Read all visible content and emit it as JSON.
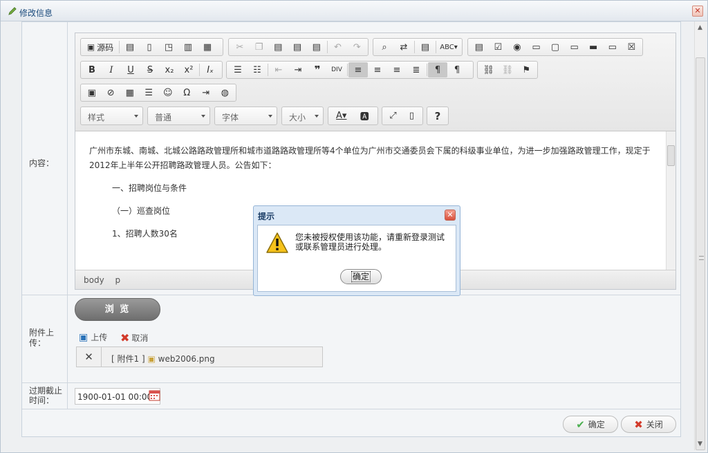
{
  "window": {
    "title": "修改信息",
    "close_glyph": "✕"
  },
  "form": {
    "content_label": "内容：",
    "attachment_label": "附件上传：",
    "deadline_label": "过期截止时间："
  },
  "toolbar": {
    "source_label": "源码",
    "style_combo": "样式",
    "format_combo": "普通",
    "font_combo": "字体",
    "size_combo": "大小"
  },
  "editor": {
    "paragraph1": "广州市东城、南城、北城公路路政管理所和城市道路路政管理所等4个单位为广州市交通委员会下属的科级事业单位，为进一步加强路政管理工作，现定于2012年上半年公开招聘路政管理人员。公告如下：",
    "paragraph2": "一、招聘岗位与条件",
    "paragraph3": "（一）巡查岗位",
    "paragraph4": "1、招聘人数30名",
    "path": [
      "body",
      "p"
    ]
  },
  "upload": {
    "browse_label": "浏 览",
    "upload_label": "上传",
    "cancel_label": "取消",
    "attachment_tag": "[ 附件1 ]",
    "attachment_file": "web2006.png",
    "remove_glyph": "✕"
  },
  "deadline": {
    "value": "1900-01-01 00:00"
  },
  "footer": {
    "confirm_label": "确定",
    "close_label": "关闭"
  },
  "dialog": {
    "title": "提示",
    "message": "您未被授权使用该功能，请重新登录测试或联系管理员进行处理。",
    "ok_label": "确定"
  },
  "icons": {
    "title": "pencil-icon",
    "warning": "warning-triangle-icon",
    "calendar": "calendar-icon"
  }
}
